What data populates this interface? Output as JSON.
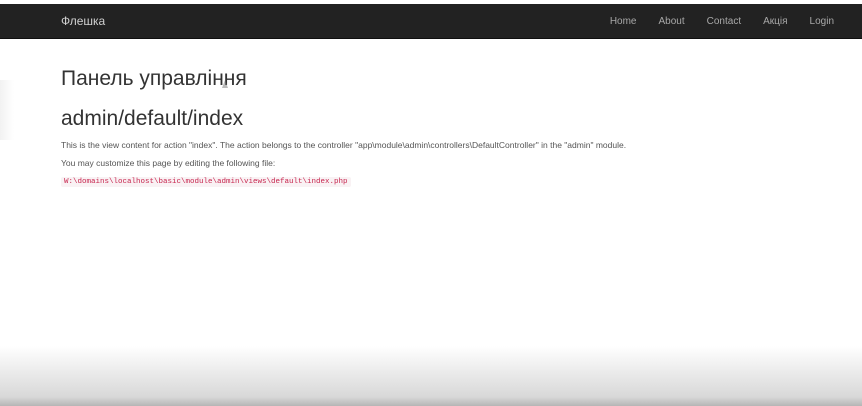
{
  "navbar": {
    "brand": "Флешка",
    "items": [
      {
        "label": "Home"
      },
      {
        "label": "About"
      },
      {
        "label": "Contact"
      },
      {
        "label": "Акція"
      },
      {
        "label": "Login"
      }
    ]
  },
  "main": {
    "panel_title": "Панель управління",
    "route_title": "admin/default/index",
    "description": "This is the view content for action \"index\". The action belongs to the controller \"app\\module\\admin\\controllers\\DefaultController\" in the \"admin\" module.",
    "customize_text": "You may customize this page by editing the following file:",
    "file_path": "W:\\domains\\localhost\\basic\\module\\admin\\views\\default\\index.php"
  },
  "colors": {
    "navbar_bg": "#222222",
    "nav_text": "#a8a8a8",
    "code_text": "#c7254e"
  }
}
